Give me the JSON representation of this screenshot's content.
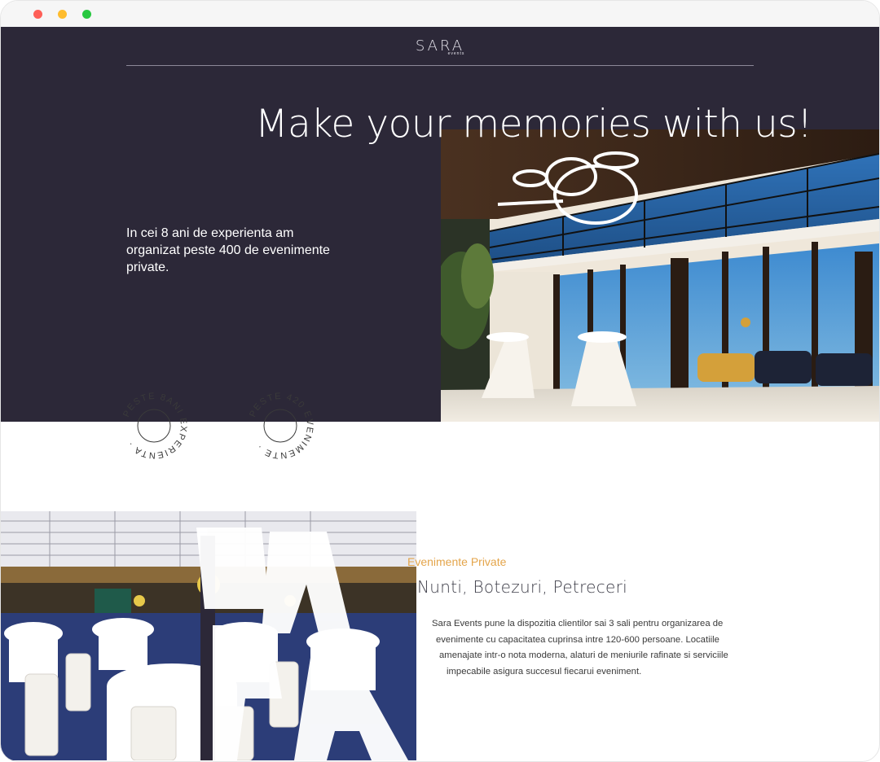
{
  "brand": {
    "logo": "SARA",
    "logo_sub": "events"
  },
  "hero": {
    "headline": "Make your memories with us!",
    "text": "In cei 8 ani de experienta am organizat peste 400 de evenimente private.",
    "badges": [
      {
        "text": "PESTE 8ANI EXPERIENTA ·"
      },
      {
        "text": "PESTE 420 EVENIMENTE ·"
      }
    ]
  },
  "events": {
    "eyebrow": "Evenimente Private",
    "title": "Nunti, Botezuri, Petreceri",
    "description_lines": [
      "Sara Events pune la dispozitia clientilor sai 3 sali pentru organizarea de",
      "evenimente cu capacitatea cuprinsa intre 120-600 persoane. Locatiile",
      "amenajate intr-o nota moderna, alaturi de meniurile rafinate si serviciile",
      "impecabile asigura succesul fiecarui eveniment."
    ],
    "overlay_letters": "SARA"
  },
  "colors": {
    "hero_bg": "#2c2838",
    "accent": "#e4a54b",
    "text_dark": "#3d3d48"
  }
}
